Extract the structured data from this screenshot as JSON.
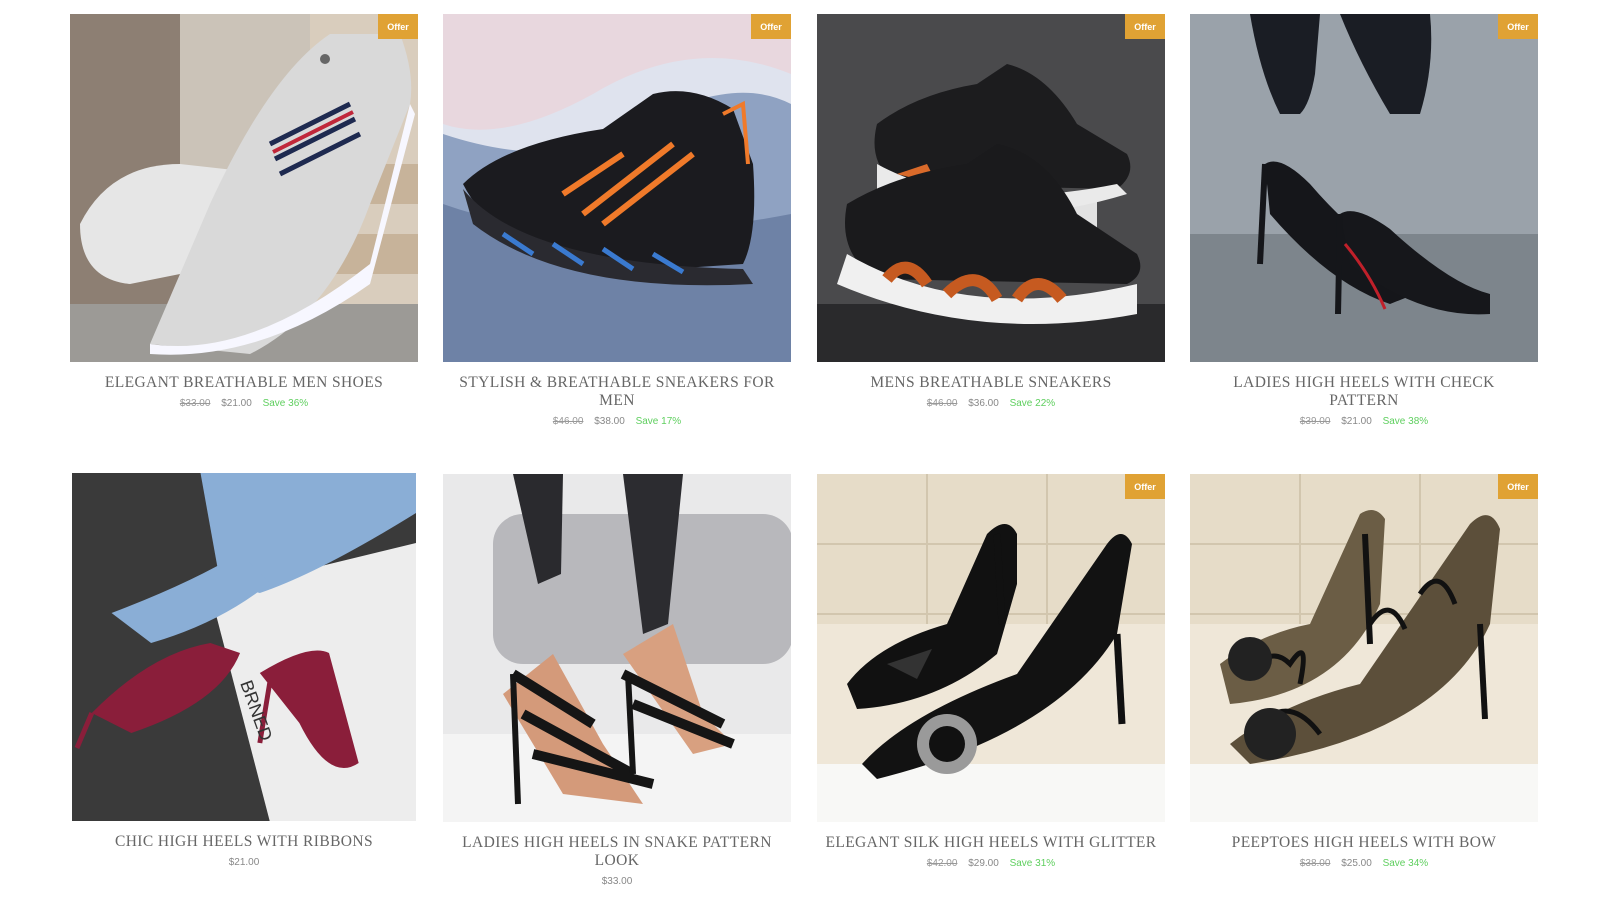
{
  "badge_label": "Offer",
  "colors": {
    "badge": "#e0a234",
    "save": "#5fcf5f"
  },
  "products": [
    {
      "title": "ELEGANT BREATHABLE MEN SHOES",
      "old_price": "$33.00",
      "price": "$21.00",
      "save": "Save 36%",
      "offer": true,
      "image": "grey canvas men shoes"
    },
    {
      "title": "STYLISH & BREATHABLE SNEAKERS FOR MEN",
      "old_price": "$46.00",
      "price": "$38.00",
      "save": "Save 17%",
      "offer": true,
      "image": "black orange sneaker"
    },
    {
      "title": "MENS BREATHABLE SNEAKERS",
      "old_price": "$46.00",
      "price": "$36.00",
      "save": "Save 22%",
      "offer": true,
      "image": "black white sneakers pair"
    },
    {
      "title": "LADIES HIGH HEELS WITH CHECK PATTERN",
      "old_price": "$39.00",
      "price": "$21.00",
      "save": "Save 38%",
      "offer": true,
      "image": "black patterned pumps"
    },
    {
      "title": "CHIC HIGH HEELS WITH RIBBONS",
      "old_price": "",
      "price": "$21.00",
      "save": "",
      "offer": false,
      "image": "burgundy strappy heels"
    },
    {
      "title": "LADIES HIGH HEELS IN SNAKE PATTERN LOOK",
      "old_price": "",
      "price": "$33.00",
      "save": "",
      "offer": false,
      "image": "black wrap sandals"
    },
    {
      "title": "ELEGANT SILK HIGH HEELS WITH GLITTER",
      "old_price": "$42.00",
      "price": "$29.00",
      "save": "Save 31%",
      "offer": true,
      "image": "black silk pumps"
    },
    {
      "title": "PEEPTOES HIGH HEELS WITH BOW",
      "old_price": "$38.00",
      "price": "$25.00",
      "save": "Save 34%",
      "offer": true,
      "image": "lace peeptoe heels"
    }
  ]
}
